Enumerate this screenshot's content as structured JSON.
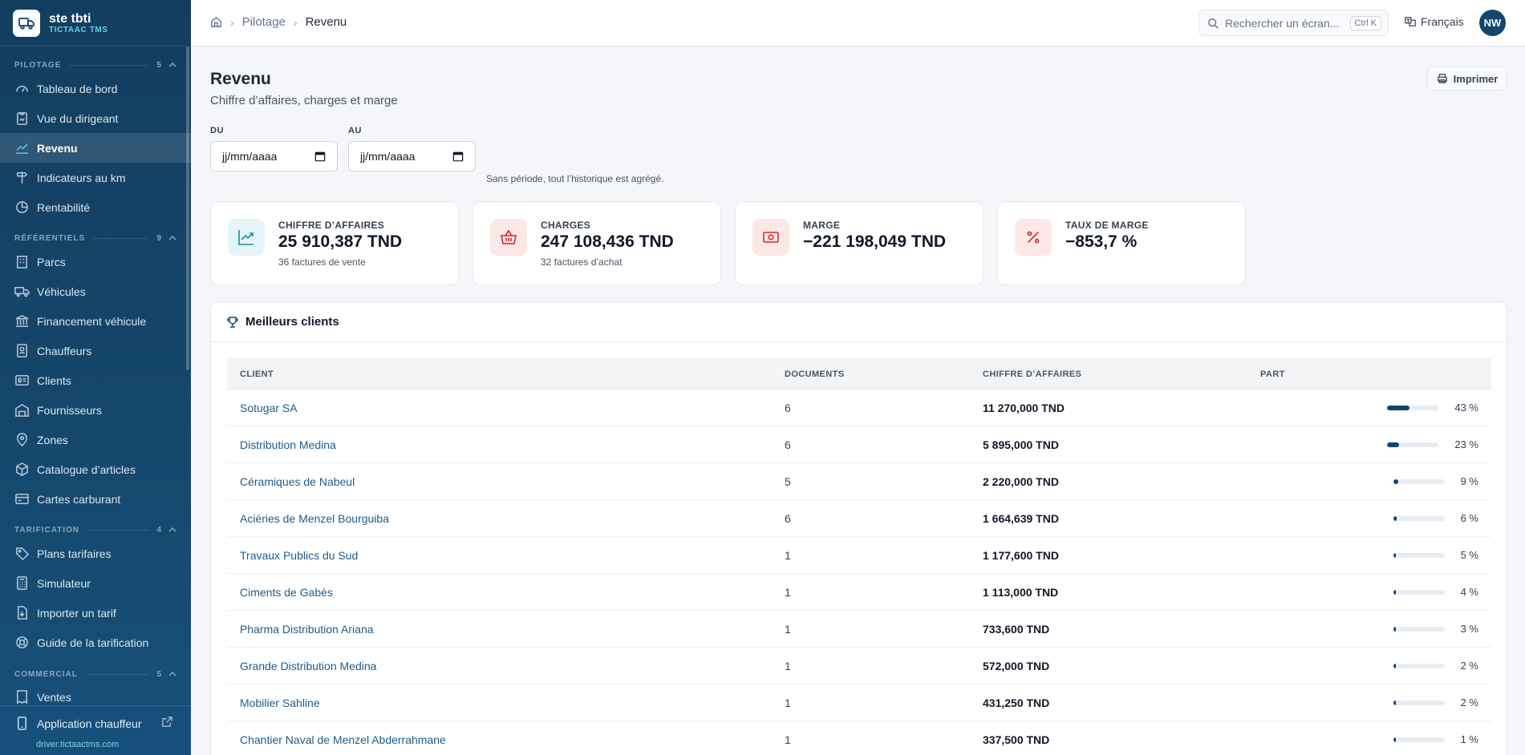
{
  "brand": {
    "name": "ste tbti",
    "sub": "TICTAAC TMS"
  },
  "sidebar": {
    "sections": [
      {
        "title": "PILOTAGE",
        "count": "5",
        "items": [
          {
            "label": "Tableau de bord",
            "icon": "gauge-icon"
          },
          {
            "label": "Vue du dirigeant",
            "icon": "clipboard-icon"
          },
          {
            "label": "Revenu",
            "icon": "trending-up-icon",
            "active": true
          },
          {
            "label": "Indicateurs au km",
            "icon": "signpost-icon"
          },
          {
            "label": "Rentabilité",
            "icon": "pie-chart-icon"
          }
        ]
      },
      {
        "title": "RÉFÉRENTIELS",
        "count": "9",
        "items": [
          {
            "label": "Parcs",
            "icon": "building-icon"
          },
          {
            "label": "Véhicules",
            "icon": "truck-icon"
          },
          {
            "label": "Financement véhicule",
            "icon": "bank-icon"
          },
          {
            "label": "Chauffeurs",
            "icon": "id-badge-icon"
          },
          {
            "label": "Clients",
            "icon": "contact-card-icon"
          },
          {
            "label": "Fournisseurs",
            "icon": "warehouse-icon"
          },
          {
            "label": "Zones",
            "icon": "map-pin-icon"
          },
          {
            "label": "Catalogue d’articles",
            "icon": "package-icon"
          },
          {
            "label": "Cartes carburant",
            "icon": "fuel-card-icon"
          }
        ]
      },
      {
        "title": "TARIFICATION",
        "count": "4",
        "items": [
          {
            "label": "Plans tarifaires",
            "icon": "tags-icon"
          },
          {
            "label": "Simulateur",
            "icon": "calculator-icon"
          },
          {
            "label": "Importer un tarif",
            "icon": "file-import-icon"
          },
          {
            "label": "Guide de la tarification",
            "icon": "lifebuoy-icon"
          }
        ]
      },
      {
        "title": "COMMERCIAL",
        "count": "5",
        "items": [
          {
            "label": "Ventes",
            "icon": "receipt-icon"
          }
        ]
      }
    ],
    "footer": {
      "app_label": "Application chauffeur",
      "url": "driver.tictaactms.com"
    }
  },
  "topbar": {
    "breadcrumb": [
      "Pilotage",
      "Revenu"
    ],
    "search_placeholder": "Rechercher un écran...",
    "search_shortcut": "Ctrl K",
    "language": "Français",
    "avatar_initials": "NW"
  },
  "page": {
    "title": "Revenu",
    "subtitle": "Chiffre d’affaires, charges et marge",
    "print_label": "Imprimer"
  },
  "filters": {
    "from_label": "DU",
    "to_label": "AU",
    "from_value": "jj/mm/aaaa",
    "to_value": "jj/mm/aaaa",
    "hint": "Sans période, tout l’historique est agrégé."
  },
  "kpis": [
    {
      "label": "CHIFFRE D’AFFAIRES",
      "value": "25 910,387 TND",
      "sub": "36 factures de vente",
      "icon": "chart-up-icon",
      "color": "#1b8fa3",
      "bg": "#e6f4f7"
    },
    {
      "label": "CHARGES",
      "value": "247 108,436 TND",
      "sub": "32 factures d’achat",
      "icon": "basket-icon",
      "color": "#dc2626",
      "bg": "#fde8e8"
    },
    {
      "label": "MARGE",
      "value": "−221 198,049 TND",
      "sub": "",
      "icon": "banknote-icon",
      "color": "#dc2626",
      "bg": "#fde8e8"
    },
    {
      "label": "TAUX DE MARGE",
      "value": "−853,7 %",
      "sub": "",
      "icon": "percent-icon",
      "color": "#dc2626",
      "bg": "#fde8e8"
    }
  ],
  "clients_table": {
    "title": "Meilleurs clients",
    "columns": [
      "CLIENT",
      "DOCUMENTS",
      "CHIFFRE D’AFFAIRES",
      "PART"
    ],
    "rows": [
      {
        "client": "Sotugar SA",
        "documents": "6",
        "ca": "11 270,000 TND",
        "part": "43 %",
        "share": 43
      },
      {
        "client": "Distribution Medina",
        "documents": "6",
        "ca": "5 895,000 TND",
        "part": "23 %",
        "share": 23
      },
      {
        "client": "Céramiques de Nabeul",
        "documents": "5",
        "ca": "2 220,000 TND",
        "part": "9 %",
        "share": 9
      },
      {
        "client": "Aciéries de Menzel Bourguiba",
        "documents": "6",
        "ca": "1 664,639 TND",
        "part": "6 %",
        "share": 6
      },
      {
        "client": "Travaux Publics du Sud",
        "documents": "1",
        "ca": "1 177,600 TND",
        "part": "5 %",
        "share": 5
      },
      {
        "client": "Ciments de Gabès",
        "documents": "1",
        "ca": "1 113,000 TND",
        "part": "4 %",
        "share": 4
      },
      {
        "client": "Pharma Distribution Ariana",
        "documents": "1",
        "ca": "733,600 TND",
        "part": "3 %",
        "share": 3
      },
      {
        "client": "Grande Distribution Medina",
        "documents": "1",
        "ca": "572,000 TND",
        "part": "2 %",
        "share": 2
      },
      {
        "client": "Mobilier Sahline",
        "documents": "1",
        "ca": "431,250 TND",
        "part": "2 %",
        "share": 2
      },
      {
        "client": "Chantier Naval de Menzel Abderrahmane",
        "documents": "1",
        "ca": "337,500 TND",
        "part": "1 %",
        "share": 1
      }
    ]
  }
}
